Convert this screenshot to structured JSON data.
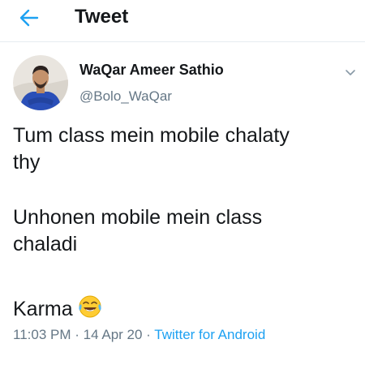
{
  "header": {
    "title": "Tweet",
    "back_icon": "arrow-left-icon",
    "accent_color": "#1da1f2"
  },
  "tweet": {
    "author": {
      "name": "WaQar Ameer Sathio",
      "handle": "@Bolo_WaQar"
    },
    "menu_icon": "chevron-down-icon",
    "text_lines": [
      "Tum class mein mobile chalaty",
      "thy",
      "Unhonen mobile mein class",
      "chaladi",
      "Karma"
    ],
    "emoji_icon": "face-with-tears-of-joy-icon",
    "time": "11:03 PM",
    "separator": "·",
    "date": "14 Apr 20",
    "source": "Twitter for Android"
  }
}
